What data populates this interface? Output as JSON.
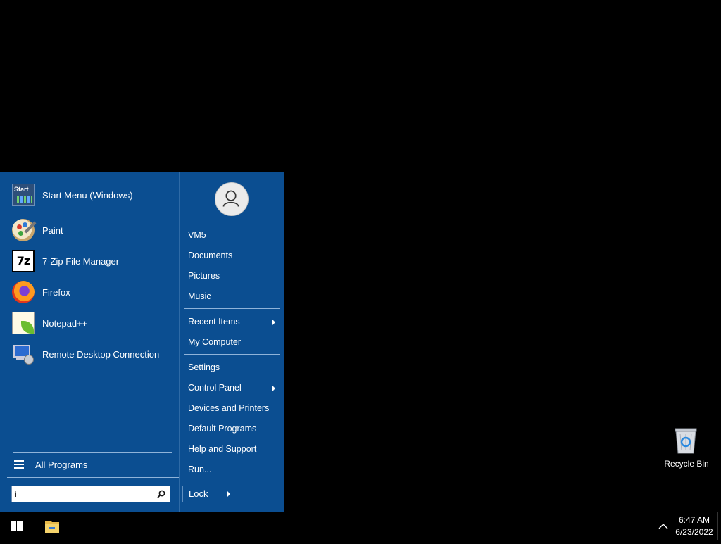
{
  "start_menu": {
    "pinned": [
      {
        "label": "Start Menu (Windows)",
        "icon": "start-menu-icon"
      }
    ],
    "programs": [
      {
        "label": "Paint",
        "icon": "paint-icon"
      },
      {
        "label": "7-Zip File Manager",
        "icon": "7zip-icon"
      },
      {
        "label": "Firefox",
        "icon": "firefox-icon"
      },
      {
        "label": "Notepad++",
        "icon": "notepad-plus-plus-icon"
      },
      {
        "label": "Remote Desktop Connection",
        "icon": "remote-desktop-icon"
      }
    ],
    "pinned_icon_text": "Start",
    "seven_zip_icon_text": "7z",
    "all_programs_label": "All Programs",
    "search": {
      "value": "i",
      "placeholder": ""
    },
    "right_links": [
      {
        "label": "VM5"
      },
      {
        "label": "Documents"
      },
      {
        "label": "Pictures"
      },
      {
        "label": "Music"
      },
      {
        "label": "Recent Items",
        "submenu": true
      },
      {
        "label": "My Computer"
      },
      {
        "label": "Settings"
      },
      {
        "label": "Control Panel",
        "submenu": true
      },
      {
        "label": "Devices and Printers"
      },
      {
        "label": "Default Programs"
      },
      {
        "label": "Help and Support"
      },
      {
        "label": "Run..."
      }
    ],
    "lock_label": "Lock"
  },
  "desktop": {
    "icons": [
      {
        "label": "Recycle Bin",
        "icon": "recycle-bin-icon"
      }
    ]
  },
  "taskbar": {
    "time": "6:47 AM",
    "date": "6/23/2022"
  },
  "colors": {
    "menu_bg": "#0b4e91",
    "desktop_bg": "#000000",
    "taskbar_bg": "#000000"
  }
}
